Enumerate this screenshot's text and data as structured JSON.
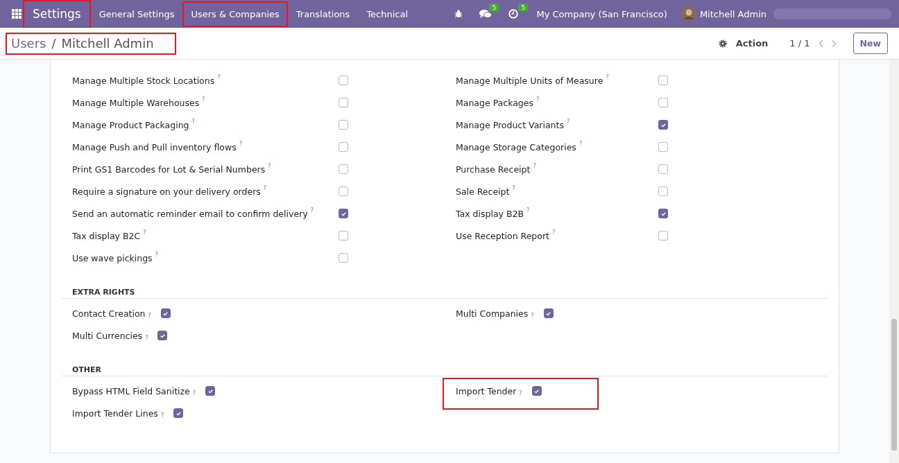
{
  "navbar": {
    "app_name": "Settings",
    "app_highlighted": true,
    "menu": [
      {
        "label": "General Settings",
        "highlighted": false
      },
      {
        "label": "Users & Companies",
        "highlighted": true
      },
      {
        "label": "Translations",
        "highlighted": false
      },
      {
        "label": "Technical",
        "highlighted": false
      }
    ],
    "messages_badge": "5",
    "activities_badge": "5",
    "company": "My Company (San Francisco)",
    "user": "Mitchell Admin"
  },
  "control_panel": {
    "breadcrumb_parent": "Users",
    "breadcrumb_separator": "/",
    "breadcrumb_current": "Mitchell Admin",
    "breadcrumb_highlighted": true,
    "action": "Action",
    "pager": "1 / 1",
    "new_button": "New"
  },
  "groups": [
    {
      "left": {
        "label": "Manage Multiple Stock Locations",
        "help": "?",
        "checked": false
      },
      "right": {
        "label": "Manage Multiple Units of Measure",
        "help": "?",
        "checked": false
      }
    },
    {
      "left": {
        "label": "Manage Multiple Warehouses",
        "help": "?",
        "checked": false
      },
      "right": {
        "label": "Manage Packages",
        "help": "?",
        "checked": false
      }
    },
    {
      "left": {
        "label": "Manage Product Packaging",
        "help": "?",
        "checked": false
      },
      "right": {
        "label": "Manage Product Variants",
        "help": "?",
        "checked": true
      }
    },
    {
      "left": {
        "label": "Manage Push and Pull inventory flows",
        "help": "?",
        "checked": false
      },
      "right": {
        "label": "Manage Storage Categories",
        "help": "?",
        "checked": false
      }
    },
    {
      "left": {
        "label": "Print GS1 Barcodes for Lot & Serial Numbers",
        "help": "?",
        "checked": false
      },
      "right": {
        "label": "Purchase Receipt",
        "help": "?",
        "checked": false
      }
    },
    {
      "left": {
        "label": "Require a signature on your delivery orders",
        "help": "?",
        "checked": false
      },
      "right": {
        "label": "Sale Receipt",
        "help": "?",
        "checked": false
      }
    },
    {
      "left": {
        "label": "Send an automatic reminder email to confirm delivery",
        "help": "?",
        "checked": true
      },
      "right": {
        "label": "Tax display B2B",
        "help": "?",
        "checked": true
      }
    },
    {
      "left": {
        "label": "Tax display B2C",
        "help": "?",
        "checked": false
      },
      "right": {
        "label": "Use Reception Report",
        "help": "?",
        "checked": false
      }
    },
    {
      "left": {
        "label": "Use wave pickings",
        "help": "?",
        "checked": false
      }
    }
  ],
  "sections": [
    {
      "title": "EXTRA RIGHTS",
      "rows": [
        {
          "left": {
            "label": "Contact Creation",
            "help": "?",
            "checked": true,
            "highlighted": false
          },
          "right": {
            "label": "Multi Companies",
            "help": "?",
            "checked": true,
            "highlighted": false
          }
        },
        {
          "left": {
            "label": "Multi Currencies",
            "help": "?",
            "checked": true,
            "highlighted": false
          }
        }
      ]
    },
    {
      "title": "OTHER",
      "rows": [
        {
          "left": {
            "label": "Bypass HTML Field Sanitize",
            "help": "?",
            "checked": true,
            "highlighted": false
          },
          "right": {
            "label": "Import Tender",
            "help": "?",
            "checked": true,
            "highlighted": true
          }
        },
        {
          "left": {
            "label": "Import Tender Lines",
            "help": "?",
            "checked": true,
            "highlighted": false
          }
        }
      ]
    }
  ]
}
